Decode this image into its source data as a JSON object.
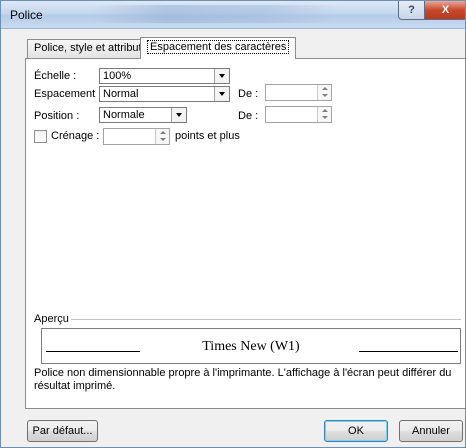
{
  "window": {
    "title": "Police",
    "help_label": "?",
    "close_label": "X"
  },
  "tabs": [
    {
      "label": "Police, style et attributs",
      "active": false
    },
    {
      "label": "Espacement des caractères",
      "active": true
    }
  ],
  "fields": {
    "echelle": {
      "label": "Échelle :",
      "value": "100%"
    },
    "espacement": {
      "label": "Espacement :",
      "value": "Normal",
      "de_label": "De :",
      "de_value": ""
    },
    "position": {
      "label": "Position :",
      "value": "Normale",
      "de_label": "De :",
      "de_value": ""
    },
    "crenage": {
      "label": "Crénage :",
      "value": "",
      "suffix": "points et plus",
      "checked": false
    }
  },
  "preview": {
    "label": "Aperçu",
    "sample_text": "Times New (W1)",
    "note": "Police non dimensionnable propre à l'imprimante. L'affichage à l'écran peut différer du résultat imprimé."
  },
  "buttons": {
    "default": "Par défaut...",
    "ok": "OK",
    "cancel": "Annuler"
  }
}
